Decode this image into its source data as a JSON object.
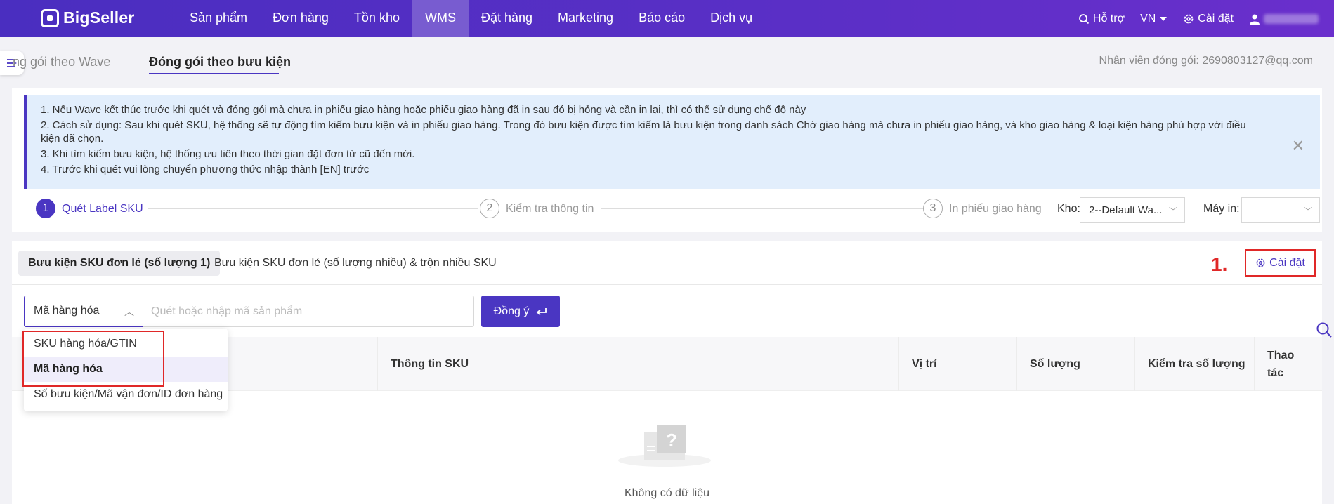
{
  "nav": {
    "brand": "BigSeller",
    "menu": [
      "Sản phẩm",
      "Đơn hàng",
      "Tồn kho",
      "WMS",
      "Đặt hàng",
      "Marketing",
      "Báo cáo",
      "Dịch vụ"
    ],
    "active_menu": "WMS",
    "support": "Hỗ trợ",
    "language": "VN",
    "settings": "Cài đặt"
  },
  "subtabs": {
    "wave": "ng gói theo Wave",
    "parcel": "Đóng gói theo bưu kiện"
  },
  "packer": "Nhân viên đóng gói: 2690803127@qq.com",
  "notice": {
    "lines": [
      "1. Nếu Wave kết thúc trước khi quét và đóng gói mà chưa in phiếu giao hàng hoặc phiếu giao hàng đã in sau đó bị hỏng và cần in lại, thì có thể sử dụng chế độ này",
      "2. Cách sử dụng: Sau khi quét SKU, hệ thống sẽ tự động tìm kiếm bưu kiện và in phiếu giao hàng. Trong đó bưu kiện được tìm kiếm là bưu kiện trong danh sách Chờ giao hàng mà chưa in phiếu giao hàng, và kho giao hàng & loại kiện hàng phù hợp với điều kiện đã chọn.",
      "3. Khi tìm kiếm bưu kiện, hệ thống ưu tiên theo thời gian đặt đơn từ cũ đến mới.",
      "4. Trước khi quét vui lòng chuyển phương thức nhập thành [EN] trước"
    ]
  },
  "steps": [
    {
      "num": "1",
      "label": "Quét Label SKU"
    },
    {
      "num": "2",
      "label": "Kiểm tra thông tin"
    },
    {
      "num": "3",
      "label": "In phiếu giao hàng"
    }
  ],
  "warehouse": {
    "label": "Kho:",
    "value": "2--Default Wa..."
  },
  "printer": {
    "label": "Máy in:",
    "value": ""
  },
  "pack_tabs": {
    "single": "Bưu kiện SKU đơn lẻ (số lượng 1)",
    "multi": "Bưu kiện SKU đơn lẻ (số lượng nhiều) & trộn nhiều SKU"
  },
  "annotation": "1.",
  "settings_button": "Cài đặt",
  "search": {
    "type": "Mã hàng hóa",
    "placeholder": "Quét hoặc nhập mã sản phẩm",
    "submit": "Đồng ý"
  },
  "dropdown_options": [
    "SKU hàng hóa/GTIN",
    "Mã hàng hóa",
    "Số bưu kiện/Mã vận đơn/ID đơn hàng"
  ],
  "table": {
    "columns": [
      "Thông tin SKU",
      "Vị trí",
      "Số lượng",
      "Kiểm tra số lượng",
      "Thao tác"
    ]
  },
  "empty": "Không có dữ liệu"
}
